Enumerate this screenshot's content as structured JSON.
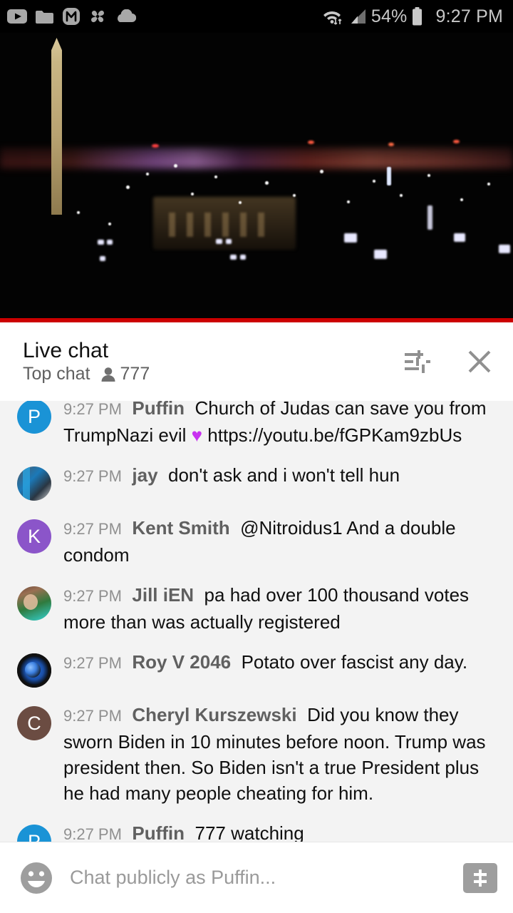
{
  "status_bar": {
    "icons": [
      "youtube-icon",
      "folder-icon",
      "m-circle-icon",
      "pinwheel-icon",
      "cloud-icon"
    ],
    "wifi_icon": "wifi-transfer-icon",
    "signal_icon": "cellular-signal-icon",
    "battery_percent": "54%",
    "battery_icon": "battery-icon",
    "clock": "9:27 PM",
    "background": "#000000",
    "text_color": "#c8c8c8"
  },
  "video": {
    "name": "live-stream-washington-dc-night",
    "progress_bar_color": "#cc0000",
    "progress_percent": 100
  },
  "chat_header": {
    "title": "Live chat",
    "mode_label": "Top chat",
    "viewer_icon": "person-icon",
    "viewer_count": "777",
    "settings_icon": "tune-sliders-icon",
    "close_icon": "close-icon"
  },
  "messages": [
    {
      "avatar_type": "letter",
      "avatar_letter": "P",
      "avatar_color": "#1a93d6",
      "time": "9:27 PM",
      "author": "Puffin",
      "text_before": "Church of Judas can save you from TrumpNazi evil ",
      "emoji": "♥",
      "text_after": " https://youtu.be/fGPKam9zbUs",
      "clipped": true
    },
    {
      "avatar_type": "photo",
      "avatar_class": "av-jay",
      "time": "9:27 PM",
      "author": "jay",
      "text": "don't ask and i won't tell hun"
    },
    {
      "avatar_type": "letter",
      "avatar_letter": "K",
      "avatar_color": "#8b55c9",
      "time": "9:27 PM",
      "author": "Kent Smith",
      "text": "@Nitroidus1 And a double condom"
    },
    {
      "avatar_type": "photo",
      "avatar_class": "av-jill",
      "time": "9:27 PM",
      "author": "Jill iEN",
      "text": "pa had over 100 thousand votes more than was actually registered"
    },
    {
      "avatar_type": "photo",
      "avatar_class": "av-roy",
      "time": "9:27 PM",
      "author": "Roy V 2046",
      "text": "Potato over fascist any day."
    },
    {
      "avatar_type": "letter",
      "avatar_letter": "C",
      "avatar_color": "#6b4c42",
      "time": "9:27 PM",
      "author": "Cheryl Kurszewski",
      "text": "Did you know they sworn Biden in 10 minutes before noon. Trump was president then. So Biden isn't a true President plus he had many people cheating for him."
    },
    {
      "avatar_type": "letter",
      "avatar_letter": "P",
      "avatar_color": "#1a93d6",
      "time": "9:27 PM",
      "author": "Puffin",
      "text": "777 watching"
    }
  ],
  "input_bar": {
    "emoji_icon": "emoji-smiley-icon",
    "placeholder": "Chat publicly as Puffin...",
    "super_chat_icon": "dollar-sign-icon"
  }
}
